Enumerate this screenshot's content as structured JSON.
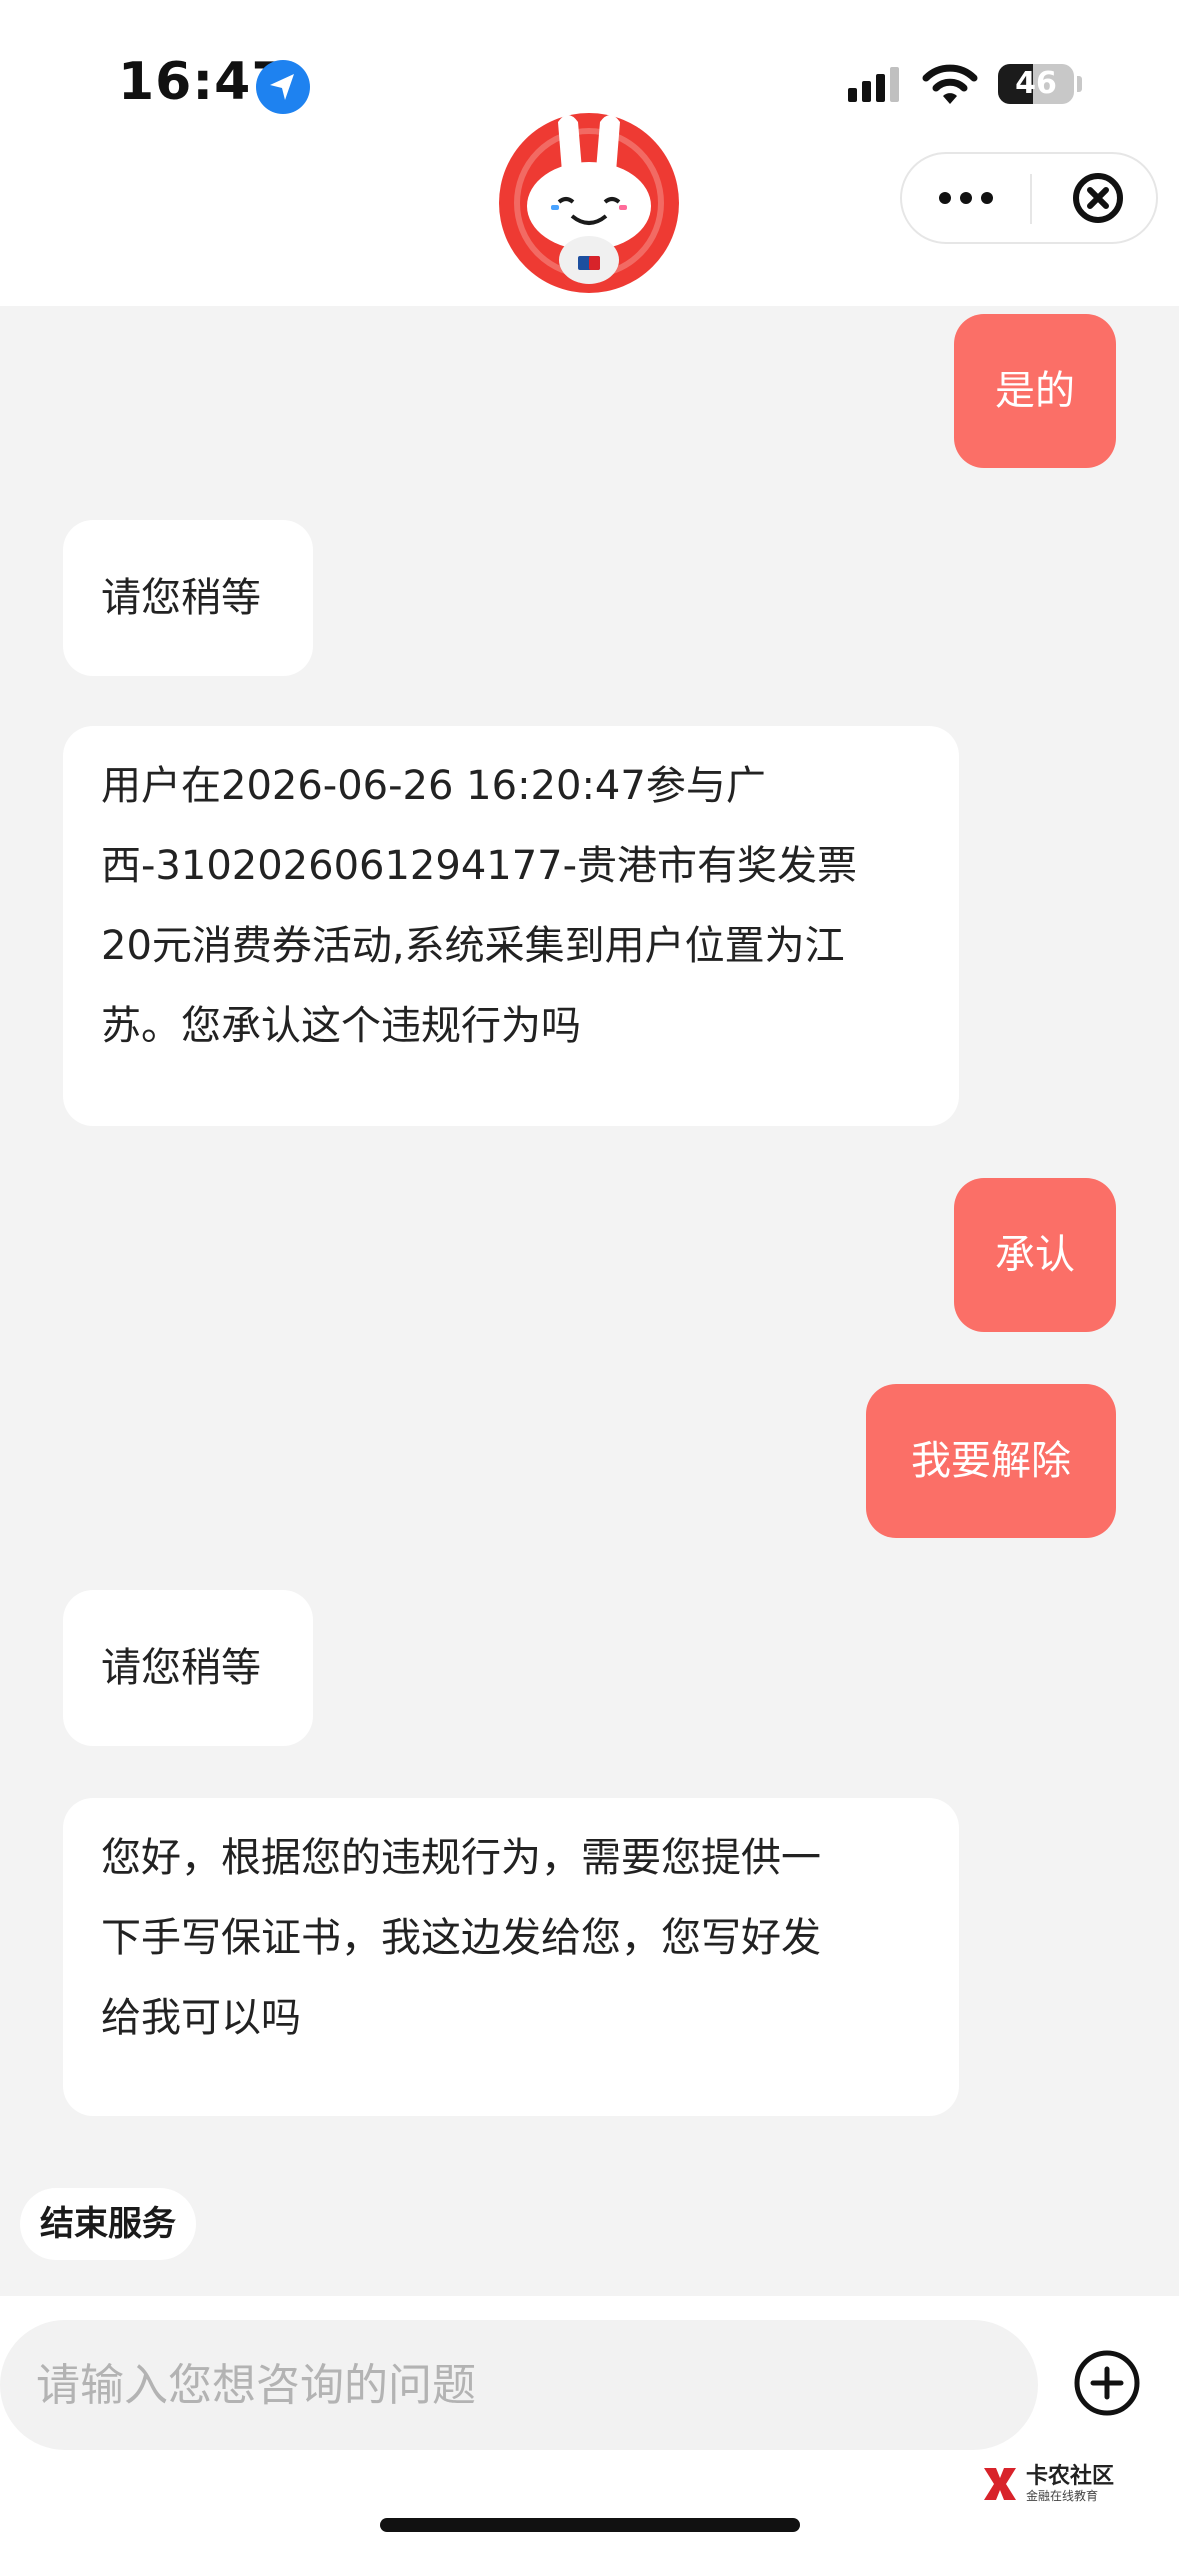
{
  "status_bar": {
    "time": "16:47",
    "battery_text": "46",
    "battery_level_percent": 46,
    "icons": [
      "location-arrow-icon",
      "cellular-signal-icon",
      "wifi-icon",
      "battery-icon"
    ]
  },
  "header": {
    "avatar_icon": "mascot-avatar-icon",
    "menu_icons": [
      "more-dots-icon",
      "close-circle-icon"
    ]
  },
  "messages": [
    {
      "role": "user",
      "text": "是的"
    },
    {
      "role": "bot",
      "text": "请您稍等"
    },
    {
      "role": "bot",
      "lines": [
        "用户在2026-06-26 16:20:47参与广",
        "西-3102026061294177-贵港市有奖发票",
        "20元消费券活动,系统采集到用户位置为江",
        "苏。您承认这个违规行为吗"
      ]
    },
    {
      "role": "user",
      "text": "承认"
    },
    {
      "role": "user",
      "text": "我要解除"
    },
    {
      "role": "bot",
      "text": "请您稍等"
    },
    {
      "role": "bot",
      "lines": [
        "您好，根据您的违规行为，需要您提供一",
        "下手写保证书，我这边发给您，您写好发",
        "给我可以吗"
      ]
    }
  ],
  "quick_actions": {
    "end_service": "结束服务"
  },
  "input": {
    "placeholder": "请输入您想咨询的问题",
    "value": ""
  },
  "watermark": {
    "name": "卡农社区",
    "subtitle": "金融在线教育"
  },
  "colors": {
    "user_bubble": "#fb6f67",
    "bot_bubble": "#ffffff",
    "chat_background": "#f3f3f3",
    "location_blue": "#1e82f0"
  }
}
